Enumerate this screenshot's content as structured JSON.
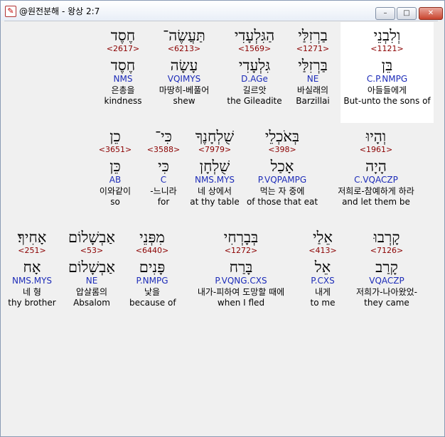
{
  "window": {
    "title": "@원전분해 - 왕상 2:7",
    "app_icon": "document-icon",
    "buttons": {
      "minimize": "–",
      "maximize": "□",
      "close": "✕"
    }
  },
  "rows": [
    [
      {
        "heb": "וְלִבְנֵי",
        "num": "<1121>",
        "root": "בֵּן",
        "parse": "C.P.NMPG",
        "kor": "아들들에게",
        "eng": "But-unto the sons of"
      },
      {
        "heb": "בַרְזִלַּי",
        "num": "<1271>",
        "root": "בַּרְזִלַּי",
        "parse": "NE",
        "kor": "바실래의",
        "eng": "Barzillai"
      },
      {
        "heb": "הַגִּלְעָדִי",
        "num": "<1569>",
        "root": "גִּלְעָדִי",
        "parse": "D.AGe",
        "kor": "길르앗",
        "eng": "the Gileadite"
      },
      {
        "heb": "תַּעֲשֶׂה־",
        "num": "<6213>",
        "root": "עָשָׂה",
        "parse": "VQIMYS",
        "kor": "마땅히-베풀어",
        "eng": "shew"
      },
      {
        "heb": "חֶסֶד",
        "num": "<2617>",
        "root": "חֶסֶד",
        "parse": "NMS",
        "kor": "은총을",
        "eng": "kindness"
      }
    ],
    [
      {
        "heb": "וְהָיוּ",
        "num": "<1961>",
        "root": "הָיָה",
        "parse": "C.VQACZP",
        "kor": "저희로-참예하게 하라",
        "eng": "and let them be"
      },
      {
        "heb": "בְּאֹכְלֵי",
        "num": "<398>",
        "root": "אָכַל",
        "parse": "P.VQPAMPG",
        "kor": "먹는 자 중에",
        "eng": "of those that eat"
      },
      {
        "heb": "שֻׁלְחָנֶךָ",
        "num": "<7979>",
        "root": "שֻׁלְחָן",
        "parse": "NMS.MYS",
        "kor": "네 상에서",
        "eng": "at thy table"
      },
      {
        "heb": "כִּי־",
        "num": "<3588>",
        "root": "כִּי",
        "parse": "C",
        "kor": "-느니라",
        "eng": "for"
      },
      {
        "heb": "כֵן",
        "num": "<3651>",
        "root": "כֵּן",
        "parse": "AB",
        "kor": "이와같이",
        "eng": "so"
      }
    ],
    [
      {
        "heb": "קָרְבוּ",
        "num": "<7126>",
        "root": "קָרַב",
        "parse": "VQACZP",
        "kor": "저희가-나아왔었-",
        "eng": "they came"
      },
      {
        "heb": "אֵלַי",
        "num": "<413>",
        "root": "אֵל",
        "parse": "P.CXS",
        "kor": "내게",
        "eng": "to me"
      },
      {
        "heb": "בְּבָרְחִי",
        "num": "<1272>",
        "root": "בָּרַח",
        "parse": "P.VQNG.CXS",
        "kor": "내가-피하여 도망할 때에",
        "eng": "when I fled"
      },
      {
        "heb": "מִפְּנֵי",
        "num": "<6440>",
        "root": "פָּנִים",
        "parse": "P.NMPG",
        "kor": "낯을",
        "eng": "because of"
      },
      {
        "heb": "אַבְשָׁלוֹם",
        "num": "<53>",
        "root": "אַבְשָׁלוֹם",
        "parse": "NE",
        "kor": "압살롬의",
        "eng": "Absalom"
      },
      {
        "heb": "אָחִיךָ׃",
        "num": "<251>",
        "root": "אָח",
        "parse": "NMS.MYS",
        "kor": "네 형",
        "eng": "thy brother"
      }
    ]
  ]
}
